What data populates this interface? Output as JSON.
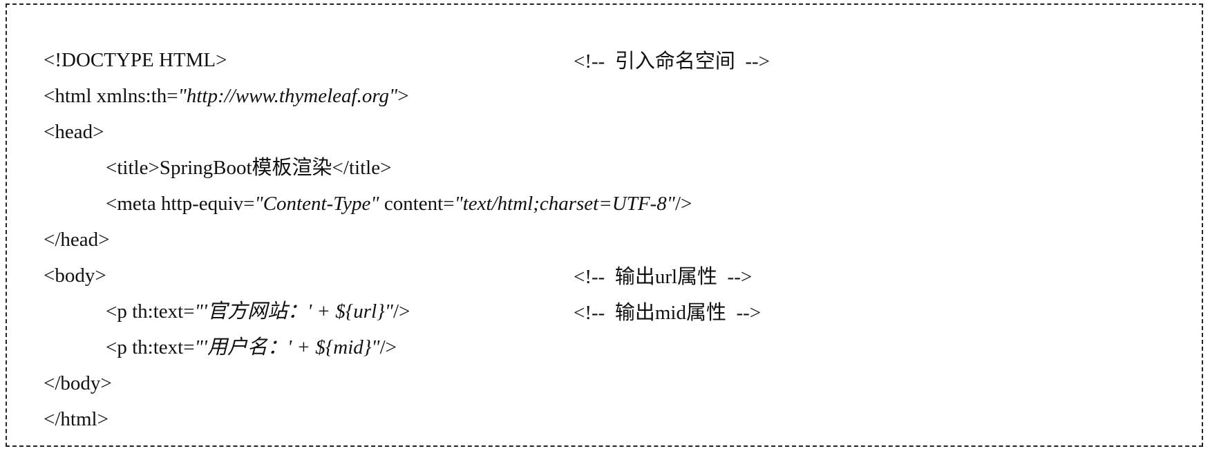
{
  "code": {
    "line1": {
      "text": "<!DOCTYPE HTML>"
    },
    "line2": {
      "pre": "<html xmlns:th=",
      "str": "\"http://www.thymeleaf.org\"",
      "post": ">",
      "comment": "<!--  引入命名空间  -->"
    },
    "line3": {
      "text": "<head>"
    },
    "line4": {
      "text": "<title>SpringBoot模板渲染</title>"
    },
    "line5": {
      "pre": "<meta http-equiv=",
      "str1": "\"Content-Type\"",
      "mid": " content=",
      "str2": "\"text/html;charset=UTF-8\"",
      "post": "/>"
    },
    "line6": {
      "text": "</head>"
    },
    "line7": {
      "text": "<body>"
    },
    "line8": {
      "pre": "<p th:text=",
      "str": "\"'官方网站：' + ${url}\"",
      "post": "/>",
      "comment": "<!--  输出url属性  -->"
    },
    "line9": {
      "pre": "<p th:text=",
      "str": "\"'用户名：' + ${mid}\"",
      "post": "/>",
      "comment": "<!--  输出mid属性  -->"
    },
    "line10": {
      "text": "</body>"
    },
    "line11": {
      "text": "</html>"
    }
  }
}
